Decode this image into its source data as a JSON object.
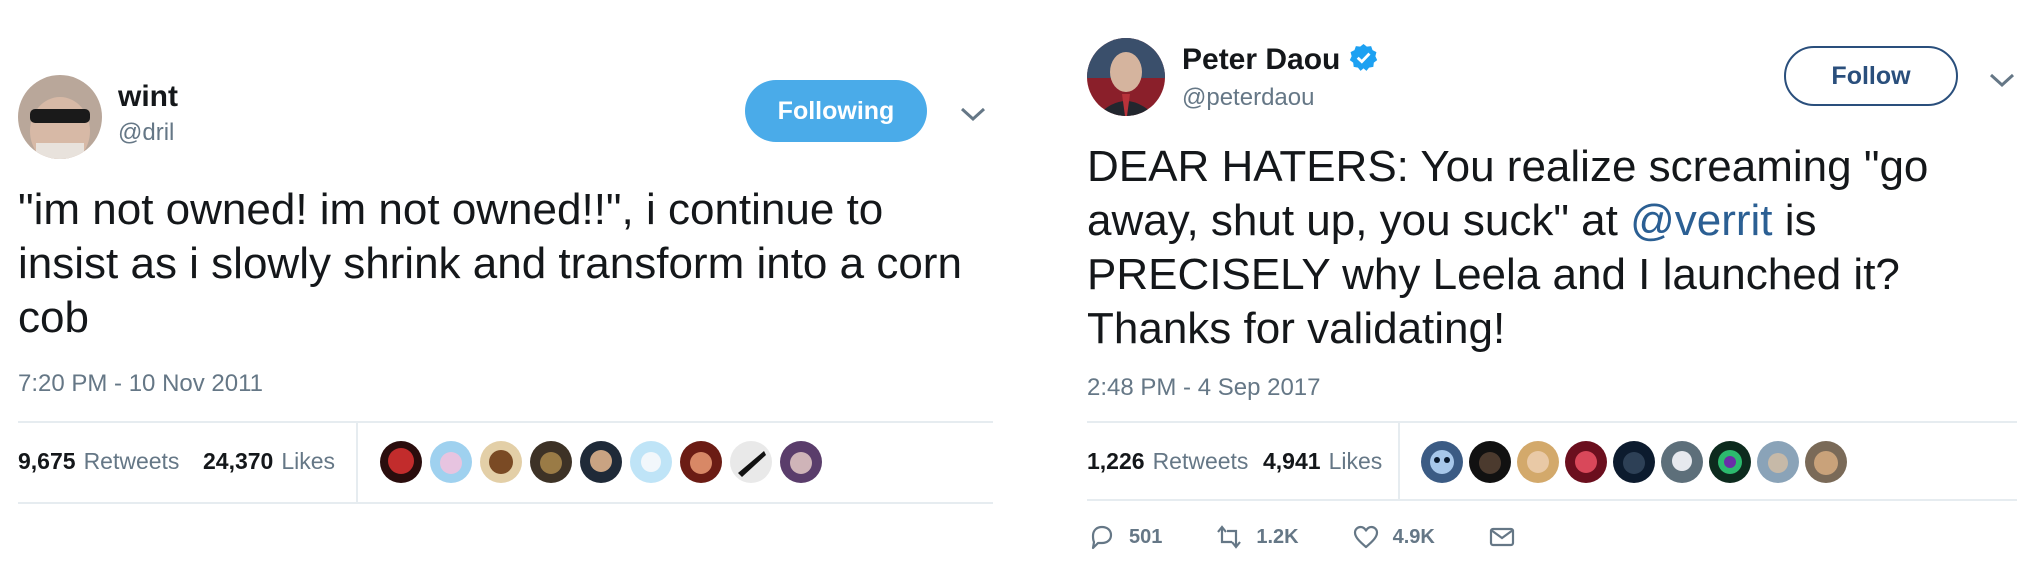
{
  "tweets": [
    {
      "name": "wint",
      "handle": "@dril",
      "follow_button": "Following",
      "text": "\"im not owned!  im not owned!!\", i continue to insist as i slowly shrink and transform into a corn cob",
      "timestamp": "7:20 PM - 10 Nov 2011",
      "retweets": {
        "count": "9,675",
        "label": "Retweets"
      },
      "likes": {
        "count": "24,370",
        "label": "Likes"
      }
    },
    {
      "name": "Peter Daou",
      "handle": "@peterdaou",
      "verified": true,
      "follow_button": "Follow",
      "text_before": "DEAR HATERS: You realize screaming \"go away, shut up, you suck\" at ",
      "mention": "@verrit",
      "text_after": " is PRECISELY why Leela and I launched it? Thanks for validating!",
      "timestamp": "2:48 PM - 4 Sep 2017",
      "retweets": {
        "count": "1,226",
        "label": "Retweets"
      },
      "likes": {
        "count": "4,941",
        "label": "Likes"
      },
      "actions": {
        "replies": "501",
        "retweets": "1.2K",
        "likes": "4.9K"
      }
    }
  ],
  "colors": {
    "following_bg": "#4aabe9",
    "follow_border": "#2a4f7c",
    "mention": "#2b5f93",
    "muted": "#657786",
    "verified": "#1da1f2"
  },
  "icons": [
    "chevron-down-icon",
    "verified-icon",
    "reply-icon",
    "retweet-icon",
    "like-icon",
    "message-icon"
  ]
}
